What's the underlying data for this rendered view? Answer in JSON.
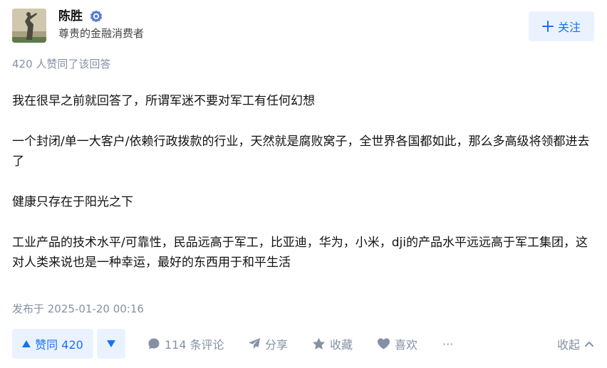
{
  "author": {
    "name": "陈胜",
    "bio": "尊贵的金融消费者",
    "follow_label": "关注"
  },
  "upvoters": "420 人赞同了该回答",
  "content": {
    "paragraphs": [
      "我在很早之前就回答了，所谓军迷不要对军工有任何幻想",
      "一个封闭/单一大客户/依赖行政拨款的行业，天然就是腐败窝子，全世界各国都如此，那么多高级将领都进去了",
      "健康只存在于阳光之下",
      "工业产品的技术水平/可靠性，民品远高于军工，比亚迪，华为，小米，dji的产品水平远远高于军工集团，这对人类来说也是一种幸运，最好的东西用于和平生活"
    ]
  },
  "published": "发布于 2025-01-20 00:16",
  "actions": {
    "upvote_label": "赞同 420",
    "comments_label": "114 条评论",
    "share_label": "分享",
    "collect_label": "收藏",
    "like_label": "喜欢",
    "more_label": "···",
    "collapse_label": "收起"
  },
  "colors": {
    "accent": "#1772f6",
    "accent_bg": "#ebf2ff",
    "muted": "#8590a6",
    "text": "#121212"
  }
}
